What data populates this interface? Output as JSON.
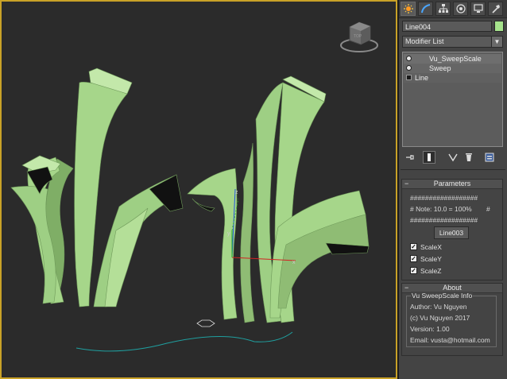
{
  "viewport": {
    "gizmo_label": "TOP",
    "colors": {
      "background": "#2b2b2b",
      "mesh": "#a6d68a",
      "border": "#c9a227",
      "spline": "#1fa0a0",
      "axis_x": "#d22222",
      "axis_y": "#22aa22",
      "axis_z": "#2255dd"
    }
  },
  "command_panel": {
    "tabs": [
      {
        "icon": "create-icon",
        "active": true
      },
      {
        "icon": "modify-icon",
        "active": false
      },
      {
        "icon": "hierarchy-icon",
        "active": false
      },
      {
        "icon": "motion-icon",
        "active": false
      },
      {
        "icon": "display-icon",
        "active": false
      },
      {
        "icon": "utilities-icon",
        "active": false
      }
    ],
    "object_name": "Line004",
    "object_color": "#a6e38c",
    "modifier_list_label": "Modifier List",
    "stack": [
      {
        "label": "Vu_SweepScale",
        "icon": "bulb-icon",
        "indent": 1
      },
      {
        "label": "Sweep",
        "icon": "bulb-icon",
        "indent": 2
      },
      {
        "label": "Line",
        "icon": "plus-icon",
        "indent": 0
      }
    ],
    "stack_tools": [
      "pin-stack-icon",
      "show-end-result-icon",
      "make-unique-icon",
      "remove-modifier-icon",
      "configure-sets-icon"
    ]
  },
  "parameters": {
    "title": "Parameters",
    "hash_line_1": "##################",
    "note": "# Note: 10.0 = 100%",
    "note_hash": "#",
    "hash_line_2": "##################",
    "button_label": "Line003",
    "checkboxes": [
      {
        "label": "ScaleX",
        "checked": true
      },
      {
        "label": "ScaleY",
        "checked": true
      },
      {
        "label": "ScaleZ",
        "checked": true
      }
    ]
  },
  "about": {
    "title": "About",
    "group_title": "Vu SweepScale Info",
    "author": "Author: Vu Nguyen",
    "copyright": "(c) Vu Nguyen 2017",
    "version": "Version: 1.00",
    "email": "Email: vusta@hotmail.com"
  }
}
